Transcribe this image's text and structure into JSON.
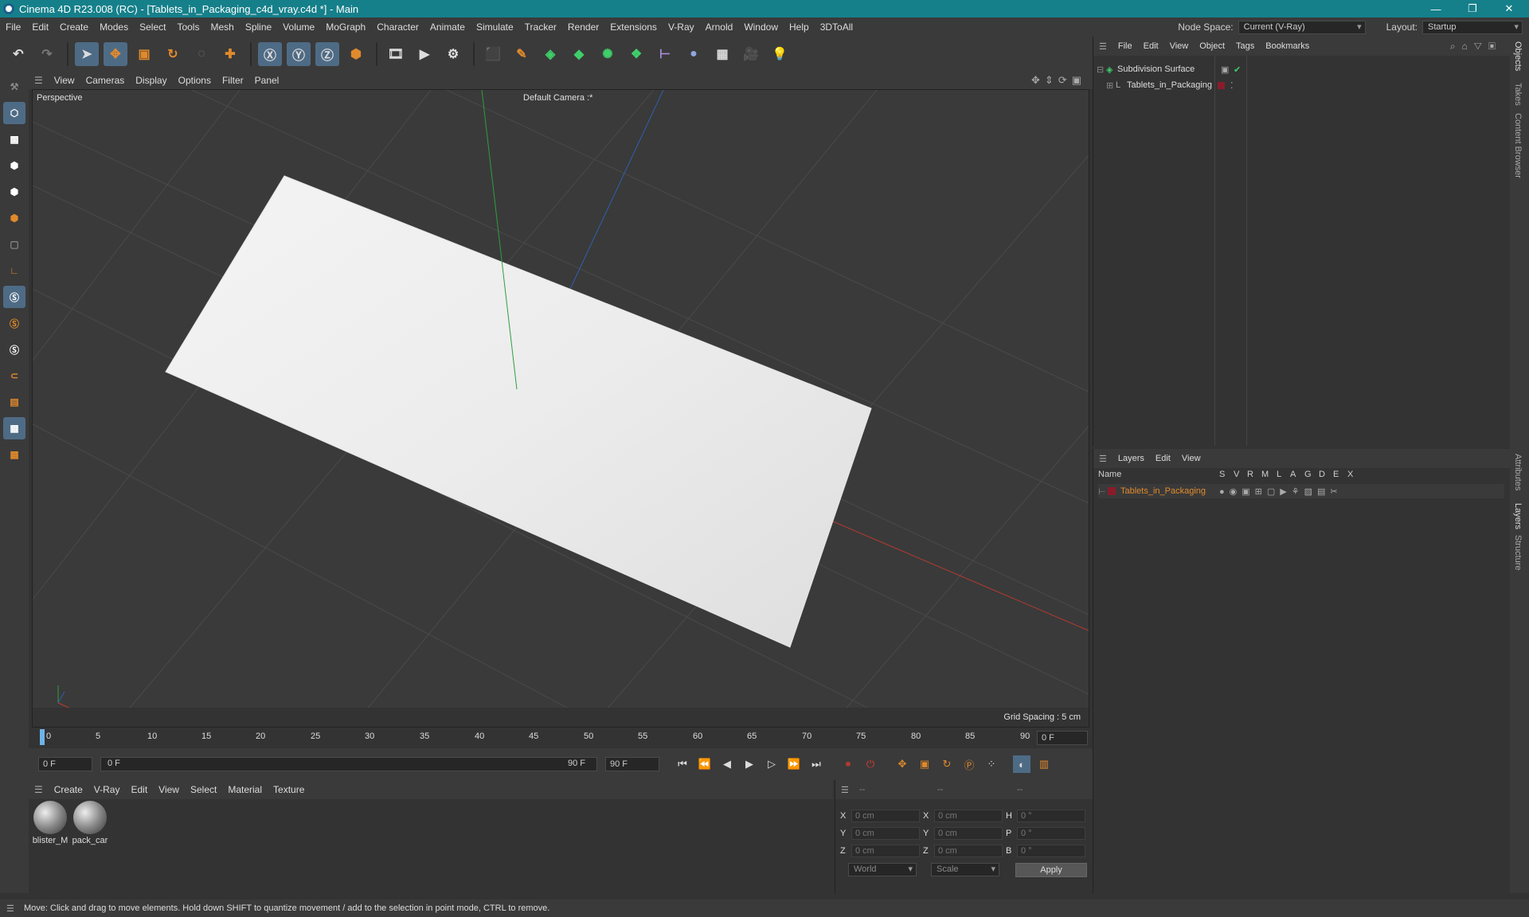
{
  "window": {
    "title": "Cinema 4D R23.008 (RC) - [Tablets_in_Packaging_c4d_vray.c4d *] - Main"
  },
  "menubar": {
    "items": [
      "File",
      "Edit",
      "Create",
      "Modes",
      "Select",
      "Tools",
      "Mesh",
      "Spline",
      "Volume",
      "MoGraph",
      "Character",
      "Animate",
      "Simulate",
      "Tracker",
      "Render",
      "Extensions",
      "V-Ray",
      "Arnold",
      "Window",
      "Help",
      "3DToAll"
    ],
    "node_space_label": "Node Space:",
    "node_space_value": "Current (V-Ray)",
    "layout_label": "Layout:",
    "layout_value": "Startup"
  },
  "viewport": {
    "menu": [
      "View",
      "Cameras",
      "Display",
      "Options",
      "Filter",
      "Panel"
    ],
    "label": "Perspective",
    "camera": "Default Camera :*",
    "grid_spacing": "Grid Spacing : 5 cm"
  },
  "timeline": {
    "ticks": [
      "0",
      "5",
      "10",
      "15",
      "20",
      "25",
      "30",
      "35",
      "40",
      "45",
      "50",
      "55",
      "60",
      "65",
      "70",
      "75",
      "80",
      "85",
      "90"
    ],
    "current_frame_right": "0 F",
    "start_field": "0 F",
    "range_start": "0 F",
    "range_end": "90 F",
    "end_field": "90 F"
  },
  "materials": {
    "menu": [
      "Create",
      "V-Ray",
      "Edit",
      "View",
      "Select",
      "Material",
      "Texture"
    ],
    "items": [
      {
        "name": "blister_M"
      },
      {
        "name": "pack_car"
      }
    ]
  },
  "coords": {
    "header": [
      "--",
      "--",
      "--"
    ],
    "rows": [
      {
        "a": "X",
        "av": "0 cm",
        "b": "X",
        "bv": "0 cm",
        "c": "H",
        "cv": "0 °"
      },
      {
        "a": "Y",
        "av": "0 cm",
        "b": "Y",
        "bv": "0 cm",
        "c": "P",
        "cv": "0 °"
      },
      {
        "a": "Z",
        "av": "0 cm",
        "b": "Z",
        "bv": "0 cm",
        "c": "B",
        "cv": "0 °"
      }
    ],
    "mode1": "World",
    "mode2": "Scale",
    "apply": "Apply"
  },
  "objects": {
    "menu": [
      "File",
      "Edit",
      "View",
      "Object",
      "Tags",
      "Bookmarks"
    ],
    "items": [
      {
        "name": "Subdivision Surface"
      },
      {
        "name": "Tablets_in_Packaging"
      }
    ]
  },
  "layers": {
    "menu": [
      "Layers",
      "Edit",
      "View"
    ],
    "col_name": "Name",
    "cols": [
      "S",
      "V",
      "R",
      "M",
      "L",
      "A",
      "G",
      "D",
      "E",
      "X"
    ],
    "items": [
      {
        "name": "Tablets_in_Packaging"
      }
    ]
  },
  "side_tabs": [
    "Objects",
    "Takes",
    "Content Browser",
    "Attributes",
    "Layers",
    "Structure"
  ],
  "status": "Move: Click and drag to move elements. Hold down SHIFT to quantize movement / add to the selection in point mode, CTRL to remove.",
  "colors": {
    "title_bar": "#15808a",
    "accent_orange": "#e08a2c",
    "layer_color": "#8a1c2a",
    "axis_x": "#c0392b",
    "axis_y": "#2e9e3e",
    "axis_z": "#2f5fb0"
  }
}
